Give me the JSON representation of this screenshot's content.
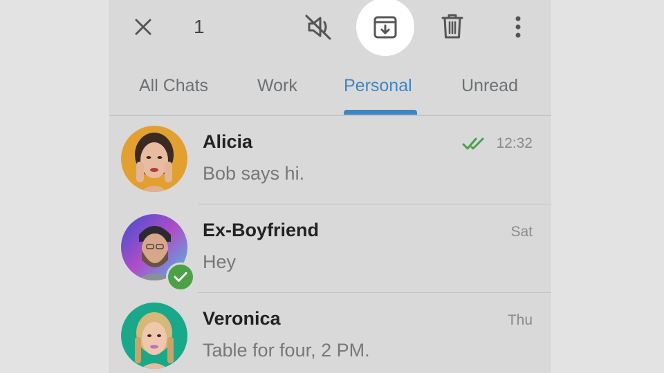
{
  "action_bar": {
    "selected_count": "1",
    "icons": [
      "close-icon",
      "mute-icon",
      "archive-icon",
      "delete-icon",
      "more-vert-icon"
    ]
  },
  "tabs": [
    {
      "label": "All Chats",
      "active": false
    },
    {
      "label": "Work",
      "active": false
    },
    {
      "label": "Personal",
      "active": true
    },
    {
      "label": "Unread",
      "active": false
    }
  ],
  "chats": [
    {
      "name": "Alicia",
      "message": "Bob says hi.",
      "time": "12:32",
      "read": true,
      "selected": false
    },
    {
      "name": "Ex-Boyfriend",
      "message": "Hey",
      "time": "Sat",
      "read": false,
      "selected": true
    },
    {
      "name": "Veronica",
      "message": "Table for four, 2 PM.",
      "time": "Thu",
      "read": false,
      "selected": false
    }
  ],
  "colors": {
    "accent": "#3e86c1",
    "read_check": "#4aa146",
    "selected_badge": "#4aa146",
    "background": "#d9d9d9"
  }
}
